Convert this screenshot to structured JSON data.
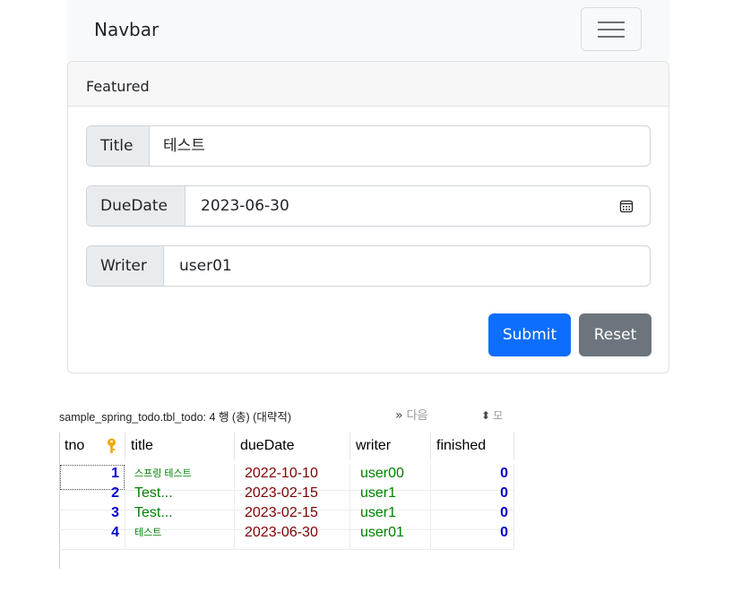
{
  "navbar": {
    "brand": "Navbar",
    "toggler_icon": "hamburger-menu-icon"
  },
  "card": {
    "header": "Featured",
    "fields": {
      "title": {
        "label": "Title",
        "value": "테스트"
      },
      "duedate": {
        "label": "DueDate",
        "value": "2023-06-30",
        "icon": "calendar-icon"
      },
      "writer": {
        "label": "Writer",
        "value": "user01"
      }
    },
    "buttons": {
      "submit": "Submit",
      "reset": "Reset"
    },
    "colors": {
      "primary": "#0d6efd",
      "secondary": "#6c757d"
    }
  },
  "db": {
    "status": "sample_spring_todo.tbl_todo: 4 행 (총) (대략적)",
    "next_icon": "double-chevron-right-icon",
    "next_label": "다음",
    "sort_icon": "sort-updown-icon",
    "sort_label": "모",
    "columns": [
      "tno",
      "title",
      "dueDate",
      "writer",
      "finished"
    ],
    "key_icon": "primary-key-icon",
    "rows": [
      {
        "tno": "1",
        "title": "스프링 테스트",
        "dueDate": "2022-10-10",
        "writer": "user00",
        "finished": "0"
      },
      {
        "tno": "2",
        "title": "Test...",
        "dueDate": "2023-02-15",
        "writer": "user1",
        "finished": "0"
      },
      {
        "tno": "3",
        "title": "Test...",
        "dueDate": "2023-02-15",
        "writer": "user1",
        "finished": "0"
      },
      {
        "tno": "4",
        "title": "테스트",
        "dueDate": "2023-06-30",
        "writer": "user01",
        "finished": "0"
      }
    ],
    "colors": {
      "number": "#0000cc",
      "text": "#008000",
      "date": "#800000"
    }
  }
}
